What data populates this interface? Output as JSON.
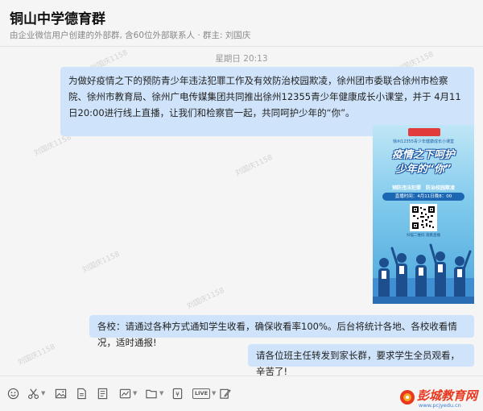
{
  "header": {
    "title": "铜山中学德育群",
    "subtitle": "由企业微信用户创建的外部群, 含60位外部联系人 · 群主: 刘国庆"
  },
  "chat": {
    "timestamp": "星期日 20:13",
    "messages": [
      {
        "text": "为做好疫情之下的预防青少年违法犯罪工作及有效防治校园欺凌，徐州团市委联合徐州市检察院、徐州市教育局、徐州广电传媒集团共同推出徐州12355青少年健康成长小课堂，并于 4月11日20:00进行线上直播，让我们和检察官一起，共同呵护少年的“你”。"
      },
      {
        "text": "各校：请通过各种方式通知学生收看，确保收看率100%。后台将统计各地、各校收看情况，适时通报!"
      },
      {
        "text": "请各位班主任转发到家长群，要求学生全员观看，辛苦了!"
      }
    ],
    "poster": {
      "subtop": "徐州12355青少年健康成长小课堂",
      "title_line1": "疫情之下呵护",
      "title_line2": "少年的“你”",
      "slogan": "预防违法犯罪　防治校园欺凌",
      "live_time": "直播时间：4月11日晚8：00",
      "scan_hint": "扫描二维码 观看直播"
    }
  },
  "toolbar": {
    "tools": [
      "emoji-icon",
      "scissors-icon",
      "image-icon",
      "file-icon",
      "chart-icon",
      "folder-icon",
      "red-packet-icon",
      "live-icon",
      "edit-icon"
    ],
    "live_label": "LIVE"
  },
  "watermark": {
    "text": "刘国庆1158"
  },
  "brand": {
    "name": "彭城教育网",
    "url": "www.pcjyedu.cn"
  },
  "colors": {
    "bubble": "#cfe4fb",
    "background": "#f5f5f5",
    "brand_red": "#e8381d"
  }
}
